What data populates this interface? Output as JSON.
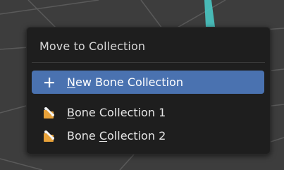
{
  "menu": {
    "title": "Move to Collection",
    "items": [
      {
        "label_ul": "N",
        "label_rest": "ew Bone Collection",
        "icon": "plus-icon",
        "active": true
      },
      {
        "label_ul": "B",
        "label_rest": "one Collection 1",
        "icon": "bone-collection-icon",
        "active": false
      },
      {
        "label_pre": "Bone ",
        "label_ul": "C",
        "label_rest": "ollection 2",
        "icon": "bone-collection-icon",
        "active": false
      }
    ]
  },
  "colors": {
    "highlight": "#4a72b0",
    "menu_bg": "#1e1e1e",
    "viewport_bg": "#3c3c3c"
  }
}
